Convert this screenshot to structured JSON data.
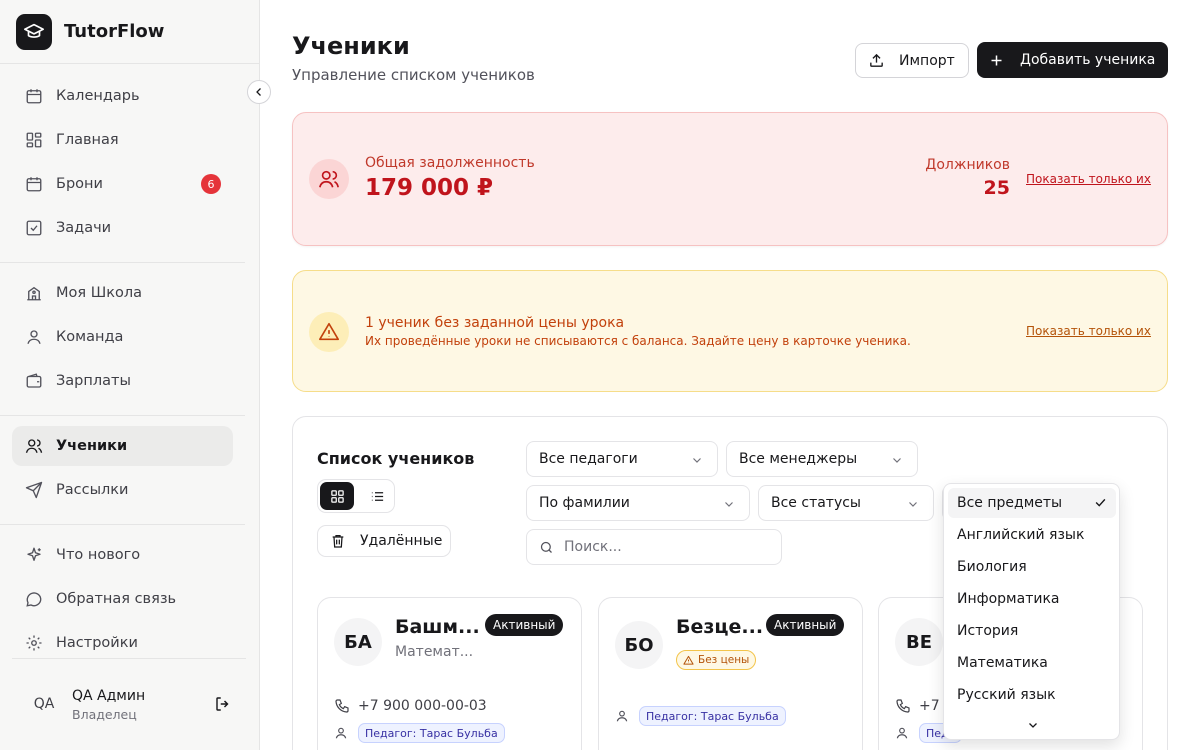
{
  "app": {
    "name": "TutorFlow"
  },
  "sidebar": {
    "groups": [
      [
        {
          "label": "Календарь",
          "icon": "calendar-icon"
        },
        {
          "label": "Главная",
          "icon": "dashboard-icon"
        },
        {
          "label": "Брони",
          "icon": "calendar-icon",
          "badge": "6"
        },
        {
          "label": "Задачи",
          "icon": "checkbox-icon"
        }
      ],
      [
        {
          "label": "Моя Школа",
          "icon": "school-icon"
        },
        {
          "label": "Команда",
          "icon": "user-icon"
        },
        {
          "label": "Зарплаты",
          "icon": "wallet-icon"
        }
      ],
      [
        {
          "label": "Ученики",
          "icon": "users-icon",
          "active": true
        },
        {
          "label": "Рассылки",
          "icon": "send-icon"
        }
      ],
      [
        {
          "label": "Что нового",
          "icon": "sparkles-icon"
        },
        {
          "label": "Обратная связь",
          "icon": "message-icon"
        },
        {
          "label": "Настройки",
          "icon": "gear-icon"
        }
      ]
    ],
    "user": {
      "initials": "QA",
      "name": "QA Админ",
      "role": "Владелец"
    }
  },
  "header": {
    "title": "Ученики",
    "subtitle": "Управление списком учеников",
    "import_label": "Импорт",
    "add_label": "Добавить ученика"
  },
  "debt": {
    "label": "Общая задолженность",
    "amount": "179 000 ₽",
    "debtors_label": "Должников",
    "debtors_count": "25",
    "link": "Показать только их"
  },
  "warning": {
    "title": "1 ученик без заданной цены урока",
    "text": "Их проведённые уроки не списываются с баланса. Задайте цену в карточке ученика.",
    "link": "Показать только их"
  },
  "list": {
    "title": "Список учеников",
    "deleted_label": "Удалённые",
    "filters": {
      "teachers": "Все педагоги",
      "managers": "Все менеджеры",
      "sort": "По фамилии",
      "statuses": "Все статусы"
    },
    "search_placeholder": "Поиск...",
    "students": [
      {
        "initials": "БА",
        "name": "Башм...",
        "subject": "Математ...",
        "status": "Активный",
        "phone": "+7 900 000-00-03",
        "teacher": "Педагог: Тарас Бульба"
      },
      {
        "initials": "БО",
        "name": "Безце...",
        "status": "Активный",
        "no_price": "Без цены",
        "teacher": "Педагог: Тарас Бульба"
      },
      {
        "initials": "ВЕ",
        "phone": "+7",
        "teacher": "Педа"
      }
    ]
  },
  "subject_dropdown": {
    "selected": "Все предметы",
    "options": [
      "Все предметы",
      "Английский язык",
      "Биология",
      "Информатика",
      "История",
      "Математика",
      "Русский язык"
    ]
  },
  "colors": {
    "accent": "#18181b",
    "danger": "#c0141c",
    "warning": "#c2410c",
    "badge": "#e5343a"
  }
}
